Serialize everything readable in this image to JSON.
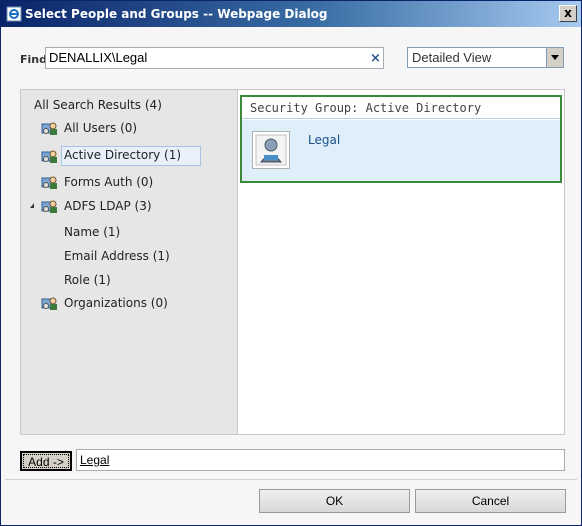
{
  "window": {
    "title": "Select People and Groups -- Webpage Dialog",
    "close_glyph": "x"
  },
  "find": {
    "label": "Find",
    "value": "DENALLIX\\Legal",
    "clear_glyph": "×"
  },
  "view": {
    "selected": "Detailed View"
  },
  "tree": {
    "root": "All Search Results (4)",
    "items": [
      {
        "label": "All Users (0)",
        "icon": "directory-icon"
      },
      {
        "label": "Active Directory (1)",
        "icon": "directory-icon",
        "selected": true
      },
      {
        "label": "Forms Auth (0)",
        "icon": "directory-icon"
      },
      {
        "label": "ADFS LDAP (3)",
        "icon": "directory-icon",
        "expanded": true
      },
      {
        "label": "Name (1)"
      },
      {
        "label": "Email Address (1)"
      },
      {
        "label": "Role (1)"
      },
      {
        "label": "Organizations (0)",
        "icon": "directory-icon"
      }
    ]
  },
  "results": {
    "group_header": "Security Group: Active Directory",
    "items": [
      {
        "name": "Legal",
        "icon": "user-group-icon"
      }
    ]
  },
  "add": {
    "button": "Add ->",
    "selected_entity": "Legal"
  },
  "actions": {
    "ok": "OK",
    "cancel": "Cancel"
  },
  "colors": {
    "title_bar": "#0a246a",
    "selection_border": "#3a8a3a",
    "link": "#1b4f8a"
  }
}
